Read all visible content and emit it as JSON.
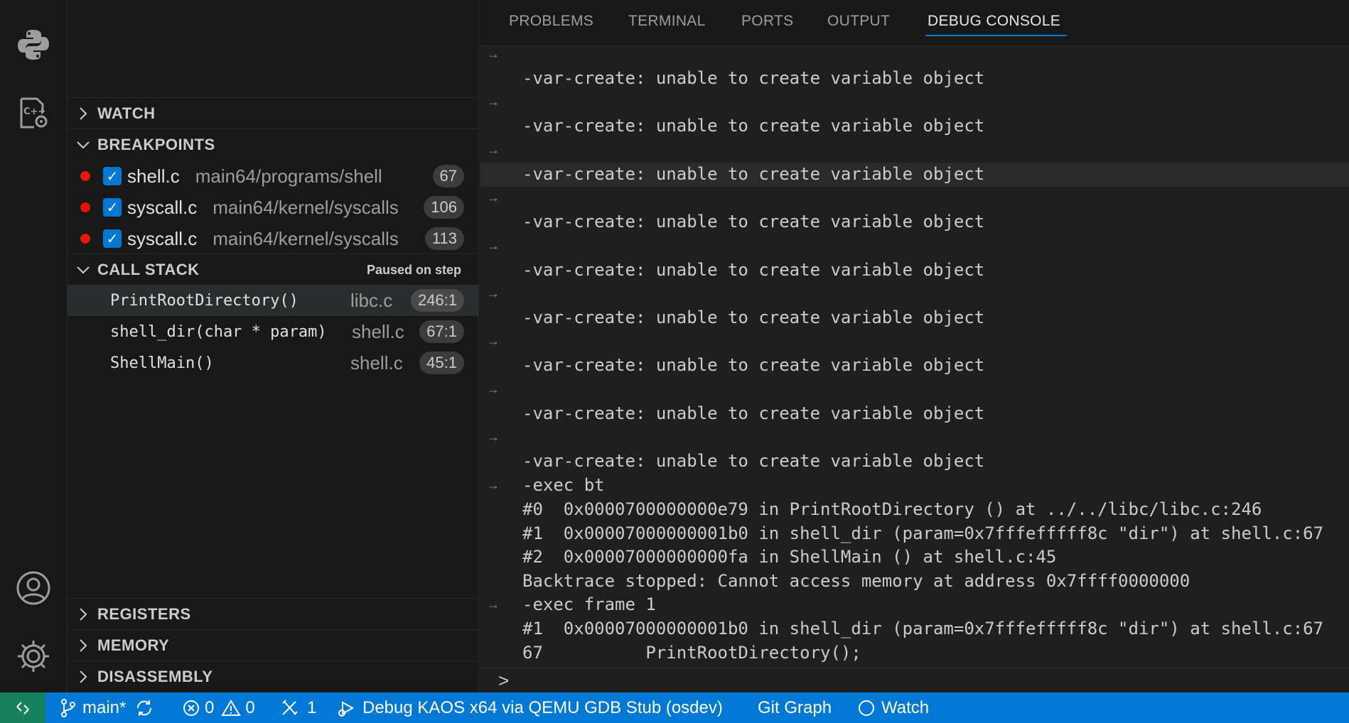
{
  "activity_bar": {
    "icons": [
      "python-icon",
      "debug-cpp-settings-icon",
      "account-icon",
      "settings-gear-icon"
    ]
  },
  "sidebar": {
    "watch": {
      "title": "WATCH"
    },
    "breakpoints": {
      "title": "BREAKPOINTS",
      "items": [
        {
          "file": "shell.c",
          "path": "main64/programs/shell",
          "line": "67"
        },
        {
          "file": "syscall.c",
          "path": "main64/kernel/syscalls",
          "line": "106"
        },
        {
          "file": "syscall.c",
          "path": "main64/kernel/syscalls",
          "line": "113"
        }
      ]
    },
    "call_stack": {
      "title": "CALL STACK",
      "status": "Paused on step",
      "frames": [
        {
          "func": "PrintRootDirectory()",
          "file": "libc.c",
          "pos": "246:1"
        },
        {
          "func": "shell_dir(char * param)",
          "file": "shell.c",
          "pos": "67:1"
        },
        {
          "func": "ShellMain()",
          "file": "shell.c",
          "pos": "45:1"
        }
      ]
    },
    "registers": {
      "title": "REGISTERS"
    },
    "memory": {
      "title": "MEMORY"
    },
    "disassembly": {
      "title": "DISASSEMBLY"
    }
  },
  "panel": {
    "tabs": [
      "PROBLEMS",
      "TERMINAL",
      "PORTS",
      "OUTPUT",
      "DEBUG CONSOLE"
    ],
    "active_tab": "DEBUG CONSOLE",
    "console": {
      "var_error": "-var-create: unable to create variable object",
      "exec_bt": "-exec bt",
      "bt0": "#0  0x0000700000000e79 in PrintRootDirectory () at ../../libc/libc.c:246",
      "bt1": "#1  0x00007000000001b0 in shell_dir (param=0x7fffefffff8c \"dir\") at shell.c:67",
      "bt2": "#2  0x00007000000000fa in ShellMain () at shell.c:45",
      "bt_stop": "Backtrace stopped: Cannot access memory at address 0x7ffff0000000",
      "exec_frame": "-exec frame 1",
      "frame1": "#1  0x00007000000001b0 in shell_dir (param=0x7fffefffff8c \"dir\") at shell.c:67",
      "src_line": "67          PrintRootDirectory();",
      "arrow": "→",
      "prompt": ">"
    }
  },
  "statusbar": {
    "branch": "main*",
    "errors": "0",
    "warnings": "0",
    "ports": "1",
    "debug": "Debug KAOS x64 via QEMU GDB Stub (osdev)",
    "git_graph": "Git Graph",
    "watch": "Watch"
  },
  "colors": {
    "accent": "#0078d4",
    "breakpoint": "#e51400",
    "remote": "#16825d"
  }
}
